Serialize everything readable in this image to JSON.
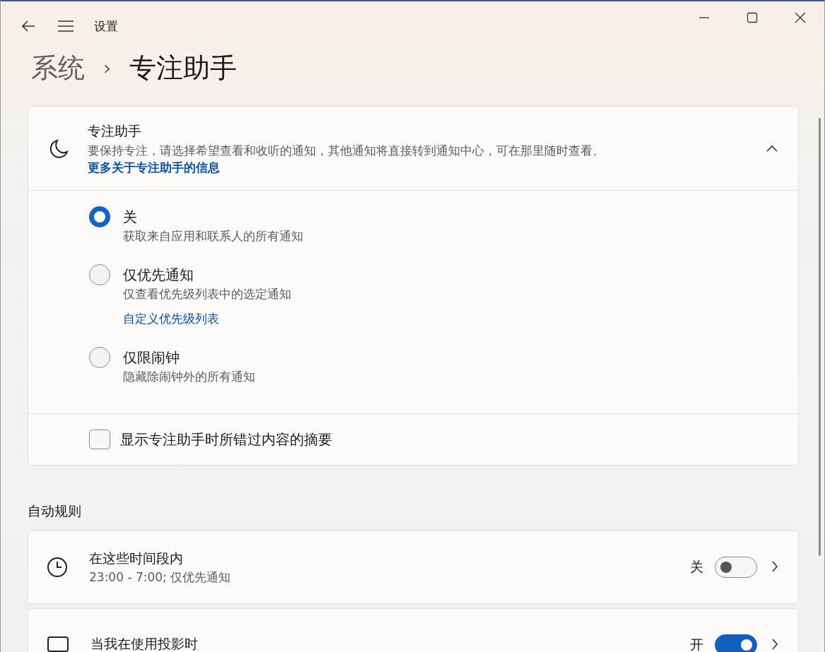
{
  "window": {
    "title": "设置"
  },
  "breadcrumb": {
    "parent": "系统",
    "separator": "›",
    "current": "专注助手"
  },
  "focus_card": {
    "title": "专注助手",
    "description": "要保持专注，请选择希望查看和收听的通知，其他通知将直接转到通知中心，可在那里随时查看。",
    "link": "更多关于专注助手的信息",
    "expanded": true,
    "options": [
      {
        "label": "关",
        "description": "获取来自应用和联系人的所有通知",
        "selected": true
      },
      {
        "label": "仅优先通知",
        "description": "仅查看优先级列表中的选定通知",
        "link": "自定义优先级列表",
        "selected": false
      },
      {
        "label": "仅限闹钟",
        "description": "隐藏除闹钟外的所有通知",
        "selected": false
      }
    ],
    "summary_checkbox": {
      "label": "显示专注助手时所错过内容的摘要",
      "checked": false
    }
  },
  "auto_rules": {
    "heading": "自动规则",
    "rules": [
      {
        "kind": "clock",
        "title": "在这些时间段内",
        "description": "23:00 - 7:00; 仅优先通知",
        "state_label": "关",
        "on": false
      },
      {
        "kind": "monitor",
        "title": "当我在使用投影时",
        "state_label": "开",
        "on": true
      }
    ]
  }
}
